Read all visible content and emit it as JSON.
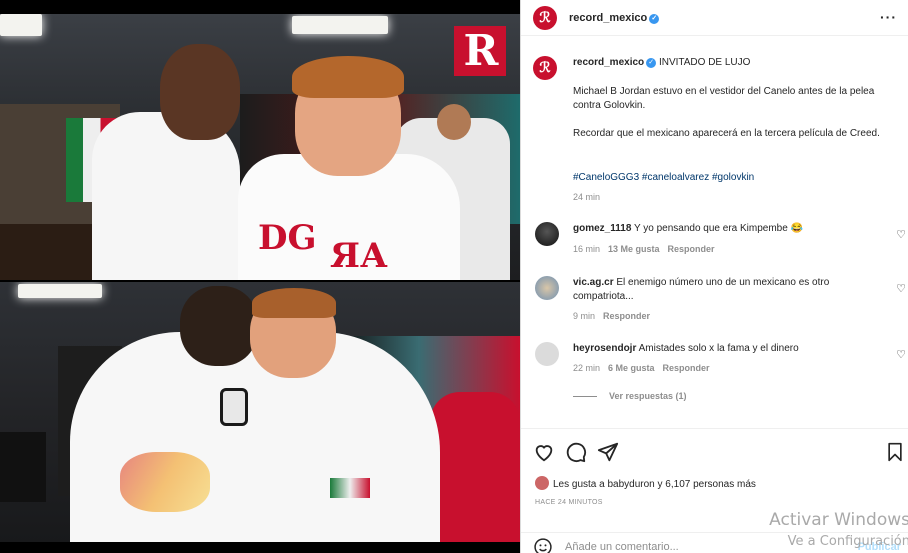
{
  "post": {
    "username": "record_mexico",
    "caption_title": "INVITADO DE LUJO",
    "caption_p1": "Michael B Jordan estuvo en el vestidor del Canelo antes de la pelea contra Golovkin.",
    "caption_p2": "Recordar que el mexicano aparecerá en la tercera película de Creed.",
    "hashtags": "#CaneloGGG3 #caneloalvarez #golovkin",
    "caption_time": "24 min",
    "photo_logo": "R"
  },
  "comments": [
    {
      "user": "gomez_1118",
      "text": "Y yo pensando que era Kimpembe 😂",
      "time": "16 min",
      "likes": "13 Me gusta",
      "reply": "Responder"
    },
    {
      "user": "vic.ag.cr",
      "text": "El enemigo número uno de un mexicano es otro compatriota...",
      "time": "9 min",
      "reply": "Responder"
    },
    {
      "user": "heyrosendojr",
      "text": "Amistades solo x la fama y el dinero",
      "time": "22 min",
      "likes": "6 Me gusta",
      "reply": "Responder",
      "view_replies": "Ver respuestas (1)"
    }
  ],
  "footer": {
    "likes_text": "Les gusta a babyduron y 6,107 personas más",
    "ago": "HACE 24 MINUTOS",
    "add_comment_placeholder": "Añade un comentario...",
    "publish": "Publicar"
  },
  "watermark": {
    "line1": "Activar Windows",
    "line2": "Ve a Configuración"
  },
  "icons": {
    "like": "heart-icon",
    "comment": "comment-icon",
    "share": "send-icon",
    "save": "bookmark-icon",
    "emoji": "emoji-icon",
    "more": "more-icon",
    "verified": "verified-badge-icon"
  },
  "colors": {
    "brand_red": "#c8102e",
    "verified_blue": "#3897f0",
    "hashtag": "#00376b",
    "meta_gray": "#8e8e8e"
  }
}
